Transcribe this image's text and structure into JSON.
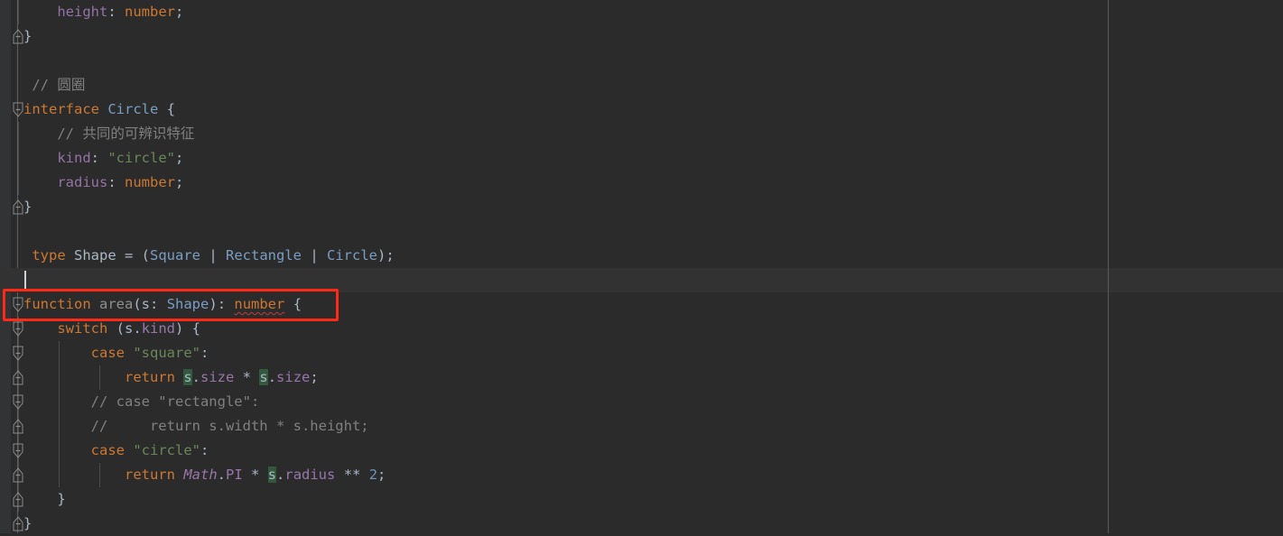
{
  "editor": {
    "theme": "darcula",
    "background": "#2b2b2b",
    "current_line_background": "#323232",
    "gutter_background": "#313335",
    "language": "TypeScript",
    "annotation": {
      "color": "#ff2a16",
      "target_line_index": 11,
      "label": "function-signature-highlight"
    }
  },
  "code": {
    "lines": [
      {
        "indent_guides": [
          20
        ],
        "fold": "none",
        "tokens": [
          {
            "t": "    ",
            "c": "punc"
          },
          {
            "t": "height",
            "c": "prop"
          },
          {
            "t": ": ",
            "c": "punc"
          },
          {
            "t": "number",
            "c": "num"
          },
          {
            "t": ";",
            "c": "punc"
          }
        ]
      },
      {
        "indent_guides": [],
        "fold": "end",
        "tokens": [
          {
            "t": "}",
            "c": "brace"
          }
        ]
      },
      {
        "indent_guides": [],
        "fold": "none",
        "tokens": []
      },
      {
        "indent_guides": [],
        "fold": "none",
        "tokens": [
          {
            "t": " // 圆圈",
            "c": "cmt"
          }
        ]
      },
      {
        "indent_guides": [],
        "fold": "start",
        "tokens": [
          {
            "t": "interface",
            "c": "kw"
          },
          {
            "t": " ",
            "c": "punc"
          },
          {
            "t": "Circle",
            "c": "cls"
          },
          {
            "t": " {",
            "c": "brace"
          }
        ]
      },
      {
        "indent_guides": [
          20
        ],
        "fold": "none",
        "tokens": [
          {
            "t": "    // 共同的可辨识特征",
            "c": "cmt"
          }
        ]
      },
      {
        "indent_guides": [
          20
        ],
        "fold": "none",
        "tokens": [
          {
            "t": "    ",
            "c": "punc"
          },
          {
            "t": "kind",
            "c": "prop"
          },
          {
            "t": ": ",
            "c": "punc"
          },
          {
            "t": "\"circle\"",
            "c": "str"
          },
          {
            "t": ";",
            "c": "punc"
          }
        ]
      },
      {
        "indent_guides": [
          20
        ],
        "fold": "none",
        "tokens": [
          {
            "t": "    ",
            "c": "punc"
          },
          {
            "t": "radius",
            "c": "prop"
          },
          {
            "t": ": ",
            "c": "punc"
          },
          {
            "t": "number",
            "c": "num"
          },
          {
            "t": ";",
            "c": "punc"
          }
        ]
      },
      {
        "indent_guides": [],
        "fold": "end",
        "tokens": [
          {
            "t": "}",
            "c": "brace"
          }
        ]
      },
      {
        "indent_guides": [],
        "fold": "none",
        "tokens": []
      },
      {
        "indent_guides": [],
        "fold": "none",
        "tokens": [
          {
            "t": " ",
            "c": "punc"
          },
          {
            "t": "type",
            "c": "kw"
          },
          {
            "t": " ",
            "c": "punc"
          },
          {
            "t": "Shape",
            "c": "ty"
          },
          {
            "t": " = (",
            "c": "punc"
          },
          {
            "t": "Square",
            "c": "cls"
          },
          {
            "t": " | ",
            "c": "punc"
          },
          {
            "t": "Rectangle",
            "c": "cls"
          },
          {
            "t": " | ",
            "c": "punc"
          },
          {
            "t": "Circle",
            "c": "cls"
          },
          {
            "t": ");",
            "c": "punc"
          }
        ]
      },
      {
        "indent_guides": [],
        "fold": "none",
        "caret": true,
        "current": true,
        "tokens": []
      },
      {
        "indent_guides": [],
        "fold": "start",
        "annotated": true,
        "tokens": [
          {
            "t": "function",
            "c": "kw"
          },
          {
            "t": " ",
            "c": "punc"
          },
          {
            "t": "area",
            "c": "fn"
          },
          {
            "t": "(",
            "c": "punc"
          },
          {
            "t": "s",
            "c": "ty"
          },
          {
            "t": ": ",
            "c": "punc"
          },
          {
            "t": "Shape",
            "c": "cls"
          },
          {
            "t": "): ",
            "c": "punc"
          },
          {
            "t": "number",
            "c": "num err"
          },
          {
            "t": " {",
            "c": "brace"
          }
        ]
      },
      {
        "indent_guides": [
          20
        ],
        "fold": "start",
        "tokens": [
          {
            "t": "    ",
            "c": "punc"
          },
          {
            "t": "switch",
            "c": "kw"
          },
          {
            "t": " (",
            "c": "punc"
          },
          {
            "t": "s",
            "c": "ty"
          },
          {
            "t": ".",
            "c": "punc"
          },
          {
            "t": "kind",
            "c": "magenta"
          },
          {
            "t": ") {",
            "c": "brace"
          }
        ]
      },
      {
        "indent_guides": [
          20,
          65
        ],
        "fold": "start",
        "tokens": [
          {
            "t": "        ",
            "c": "punc"
          },
          {
            "t": "case",
            "c": "kw"
          },
          {
            "t": " ",
            "c": "punc"
          },
          {
            "t": "\"square\"",
            "c": "str"
          },
          {
            "t": ":",
            "c": "punc"
          }
        ]
      },
      {
        "indent_guides": [
          20,
          65,
          110
        ],
        "fold": "end",
        "tokens": [
          {
            "t": "            ",
            "c": "punc"
          },
          {
            "t": "return",
            "c": "kw"
          },
          {
            "t": " ",
            "c": "punc"
          },
          {
            "t": "s",
            "c": "ty hl"
          },
          {
            "t": ".",
            "c": "punc"
          },
          {
            "t": "size",
            "c": "magenta"
          },
          {
            "t": " * ",
            "c": "punc"
          },
          {
            "t": "s",
            "c": "ty hl"
          },
          {
            "t": ".",
            "c": "punc"
          },
          {
            "t": "size",
            "c": "magenta"
          },
          {
            "t": ";",
            "c": "punc"
          }
        ]
      },
      {
        "indent_guides": [
          20,
          65
        ],
        "fold": "start",
        "tokens": [
          {
            "t": "        // case \"rectangle\":",
            "c": "cmt"
          }
        ]
      },
      {
        "indent_guides": [
          20,
          65
        ],
        "fold": "end",
        "tokens": [
          {
            "t": "        //     return s.width * s.height;",
            "c": "cmt"
          }
        ]
      },
      {
        "indent_guides": [
          20,
          65
        ],
        "fold": "start",
        "tokens": [
          {
            "t": "        ",
            "c": "punc"
          },
          {
            "t": "case",
            "c": "kw"
          },
          {
            "t": " ",
            "c": "punc"
          },
          {
            "t": "\"circle\"",
            "c": "str"
          },
          {
            "t": ":",
            "c": "punc"
          }
        ]
      },
      {
        "indent_guides": [
          20,
          65,
          110
        ],
        "fold": "end",
        "tokens": [
          {
            "t": "            ",
            "c": "punc"
          },
          {
            "t": "return",
            "c": "kw"
          },
          {
            "t": " ",
            "c": "punc"
          },
          {
            "t": "Math",
            "c": "mathcls"
          },
          {
            "t": ".",
            "c": "punc"
          },
          {
            "t": "PI",
            "c": "magenta"
          },
          {
            "t": " * ",
            "c": "punc"
          },
          {
            "t": "s",
            "c": "ty hl"
          },
          {
            "t": ".",
            "c": "punc"
          },
          {
            "t": "radius",
            "c": "magenta"
          },
          {
            "t": " ** ",
            "c": "punc"
          },
          {
            "t": "2",
            "c": "blue"
          },
          {
            "t": ";",
            "c": "punc"
          }
        ]
      },
      {
        "indent_guides": [
          20
        ],
        "fold": "end",
        "tokens": [
          {
            "t": "    }",
            "c": "brace"
          }
        ]
      },
      {
        "indent_guides": [],
        "fold": "end",
        "tokens": [
          {
            "t": "}",
            "c": "brace"
          }
        ]
      }
    ]
  },
  "source_text": "    height: number;\n}\n\n // 圆圈\ninterface Circle {\n    // 共同的可辨识特征\n    kind: \"circle\";\n    radius: number;\n}\n\n type Shape = (Square | Rectangle | Circle);\n\nfunction area(s: Shape): number {\n    switch (s.kind) {\n        case \"square\":\n            return s.size * s.size;\n        // case \"rectangle\":\n        //     return s.width * s.height;\n        case \"circle\":\n            return Math.PI * s.radius ** 2;\n    }\n}"
}
